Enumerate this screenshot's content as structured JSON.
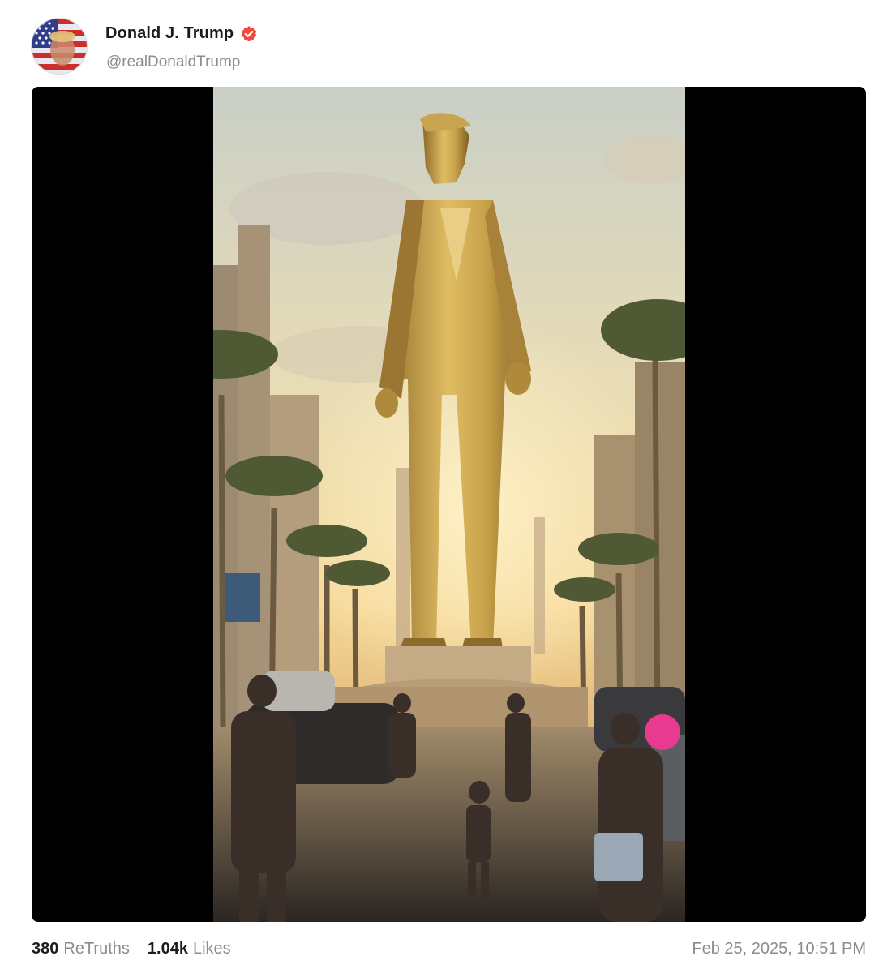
{
  "author": {
    "display_name": "Donald J. Trump",
    "handle": "@realDonaldTrump",
    "verified_icon": "verified-badge-icon",
    "verified_color": "#f04a3c"
  },
  "media": {
    "type": "video",
    "description_icon": "golden-statue-image"
  },
  "stats": {
    "retruths_count": "380",
    "retruths_label": "ReTruths",
    "likes_count": "1.04k",
    "likes_label": "Likes"
  },
  "timestamp": "Feb 25, 2025, 10:51 PM",
  "colors": {
    "text_primary": "#1b1b1b",
    "text_secondary": "#8c8c8c",
    "media_background": "#000000"
  }
}
